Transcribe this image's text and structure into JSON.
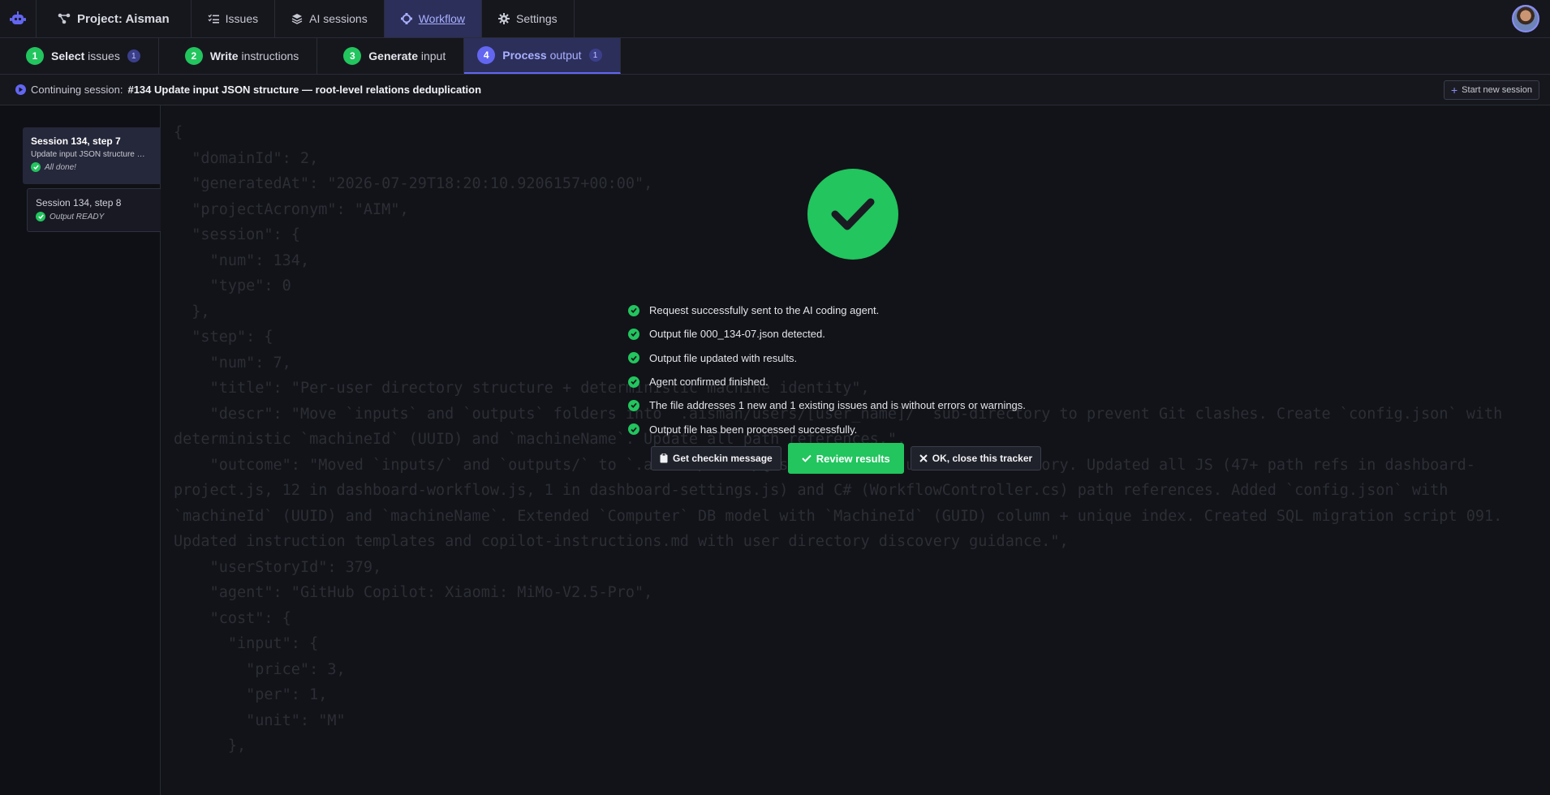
{
  "nav": {
    "project": "Project: Aisman",
    "issues": "Issues",
    "ai_sessions": "AI sessions",
    "workflow": "Workflow",
    "settings": "Settings"
  },
  "steps": [
    {
      "num": "1",
      "bold": "Select",
      "rest": " issues",
      "badge": "1"
    },
    {
      "num": "2",
      "bold": "Write",
      "rest": " instructions",
      "badge": ""
    },
    {
      "num": "3",
      "bold": "Generate",
      "rest": " input",
      "badge": ""
    },
    {
      "num": "4",
      "bold": "Process",
      "rest": " output",
      "badge": "1"
    }
  ],
  "session_bar": {
    "prefix": "Continuing session:",
    "title": "#134 Update input JSON structure — root-level relations deduplication",
    "new_session": "Start new session"
  },
  "sidebar": {
    "cards": [
      {
        "title": "Session 134, step 7",
        "desc": "Update input JSON structure — root-level relations deduplication",
        "status": "All done!"
      },
      {
        "title": "Session 134, step 8",
        "desc": "",
        "status": "Output READY"
      }
    ]
  },
  "code_text": "{\n  \"domainId\": 2,\n  \"generatedAt\": \"2026-07-29T18:20:10.9206157+00:00\",\n  \"projectAcronym\": \"AIM\",\n  \"session\": {\n    \"num\": 134,\n    \"type\": 0\n  },\n  \"step\": {\n    \"num\": 7,\n    \"title\": \"Per-user directory structure + deterministic machine identity\",\n    \"descr\": \"Move `inputs` and `outputs` folders into `.aisman/users/[user_name]/` sub-directory to prevent Git clashes. Create `config.json` with deterministic `machineId` (UUID) and `machineName`. Update all path references.\",\n    \"outcome\": \"Moved `inputs/` and `outputs/` to `.aisman/users/{userDir}/` per-user sub-directory. Updated all JS (47+ path refs in dashboard-project.js, 12 in dashboard-workflow.js, 1 in dashboard-settings.js) and C# (WorkflowController.cs) path references. Added `config.json` with `machineId` (UUID) and `machineName`. Extended `Computer` DB model with `MachineId` (GUID) column + unique index. Created SQL migration script 091. Updated instruction templates and copilot-instructions.md with user directory discovery guidance.\",\n    \"userStoryId\": 379,\n    \"agent\": \"GitHub Copilot: Xiaomi: MiMo-V2.5-Pro\",\n    \"cost\": {\n      \"input\": {\n        \"price\": 3,\n        \"per\": 1,\n        \"unit\": \"M\"\n      },",
  "messages": [
    "Request successfully sent to the AI coding agent.",
    "Output file 000_134-07.json detected.",
    "Output file updated with results.",
    "Agent confirmed finished.",
    "The file addresses 1 new and 1 existing issues and is without errors or warnings.",
    "Output file has been processed successfully."
  ],
  "actions": {
    "checkin": "Get checkin message",
    "review": "Review results",
    "close": "OK, close this tracker"
  },
  "colors": {
    "accent": "#6366f1",
    "success": "#22c55e",
    "background": "#121318"
  }
}
